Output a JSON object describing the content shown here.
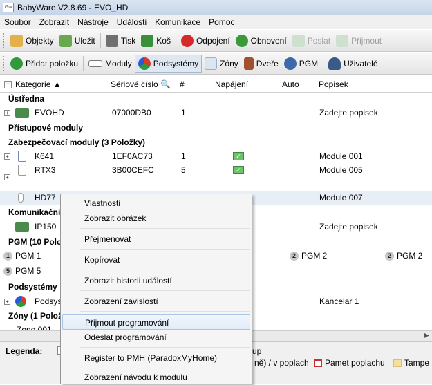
{
  "window": {
    "title": "BabyWare V2.8.69 - EVO_HD",
    "app_icon_text": "Gw"
  },
  "menubar": [
    "Soubor",
    "Zobrazit",
    "Nástroje",
    "Události",
    "Komunikace",
    "Pomoc"
  ],
  "toolbar1": [
    {
      "label": "Objekty",
      "icon": "folder-icon",
      "color": "#e3b04b"
    },
    {
      "label": "Uložit",
      "icon": "save-icon",
      "color": "#6aa84f"
    },
    {
      "label": "Tisk",
      "icon": "printer-icon",
      "color": "#707070"
    },
    {
      "label": "Koš",
      "icon": "recycle-bin-icon",
      "color": "#3a8f3a"
    },
    {
      "label": "Odpojení",
      "icon": "disconnect-icon",
      "color": "#d42a2a"
    },
    {
      "label": "Obnovení",
      "icon": "refresh-icon",
      "color": "#3a9a3a"
    },
    {
      "label": "Poslat",
      "icon": "send-icon",
      "color": "#b8d4b8"
    },
    {
      "label": "Přijmout",
      "icon": "receive-icon",
      "color": "#b8d4b8"
    }
  ],
  "toolbar2": [
    {
      "label": "Přidat položku",
      "icon": "add-icon",
      "color": "#2e9a3a"
    },
    {
      "label": "Moduly",
      "icon": "module-icon",
      "color": "#9a9a9a"
    },
    {
      "label": "Podsystémy",
      "icon": "partition-icon",
      "color": "#d83a2a"
    },
    {
      "label": "Zóny",
      "icon": "zone-icon",
      "color": "#9ab0c8"
    },
    {
      "label": "Dveře",
      "icon": "door-icon",
      "color": "#a0522d"
    },
    {
      "label": "PGM",
      "icon": "pgm-icon",
      "color": "#3a6aaa"
    },
    {
      "label": "Uživatelé",
      "icon": "user-icon",
      "color": "#3a5a8a"
    }
  ],
  "columns": {
    "category": "Kategorie",
    "serial": "Sériové číslo",
    "number": "#",
    "power": "Napájení",
    "auto": "Auto",
    "label": "Popisek"
  },
  "groups": {
    "panel": "Ústředna",
    "access": "Přístupové moduly",
    "security": "Zabezpečovací moduly (3 Položky)",
    "comm": "Komunikační",
    "pgm": "PGM (10 Polož",
    "partitions": "Podsystémy",
    "zones": "Zóny (1 Polož"
  },
  "rows": {
    "evohd": {
      "name": "EVOHD",
      "serial": "07000DB0",
      "num": "1",
      "label": "Zadejte popisek"
    },
    "k641": {
      "name": "K641",
      "serial": "1EF0AC73",
      "num": "1",
      "label": "Module 001"
    },
    "rtx3": {
      "name": "RTX3",
      "serial": "3B00CEFC",
      "num": "5",
      "label": "Module 005"
    },
    "hd77": {
      "name": "HD77",
      "label": "Module 007"
    },
    "ip150": {
      "name": "IP150",
      "label": "Zadejte popisek"
    },
    "pgm1": {
      "badge": "1",
      "name": "PGM 1"
    },
    "pgm2a": {
      "badge": "2",
      "name": "PGM 2"
    },
    "pgm2b": {
      "badge": "2",
      "name": "PGM 2"
    },
    "pgm5": {
      "badge": "5",
      "name": "PGM 5"
    },
    "podsys": {
      "name": "Podsys",
      "label": "Kancelar 1"
    },
    "zone": {
      "name": "Zone 001"
    }
  },
  "context_menu": [
    "Vlastnosti",
    "Zobrazit obrázek",
    "Přejmenovat",
    "Kopírovat",
    "Zobrazit historii událostí",
    "Zobrazení závislostí",
    "Přijmout programování",
    "Odeslat programování",
    "Register to PMH (ParadoxMyHome)",
    "Zobrazení návodu k modulu"
  ],
  "legend": {
    "label": "Legenda:",
    "partial_up": "up",
    "in_alarm": "ně) / v poplach",
    "alarm_memory": "Pamet poplachu",
    "tamper": "Tampe"
  }
}
